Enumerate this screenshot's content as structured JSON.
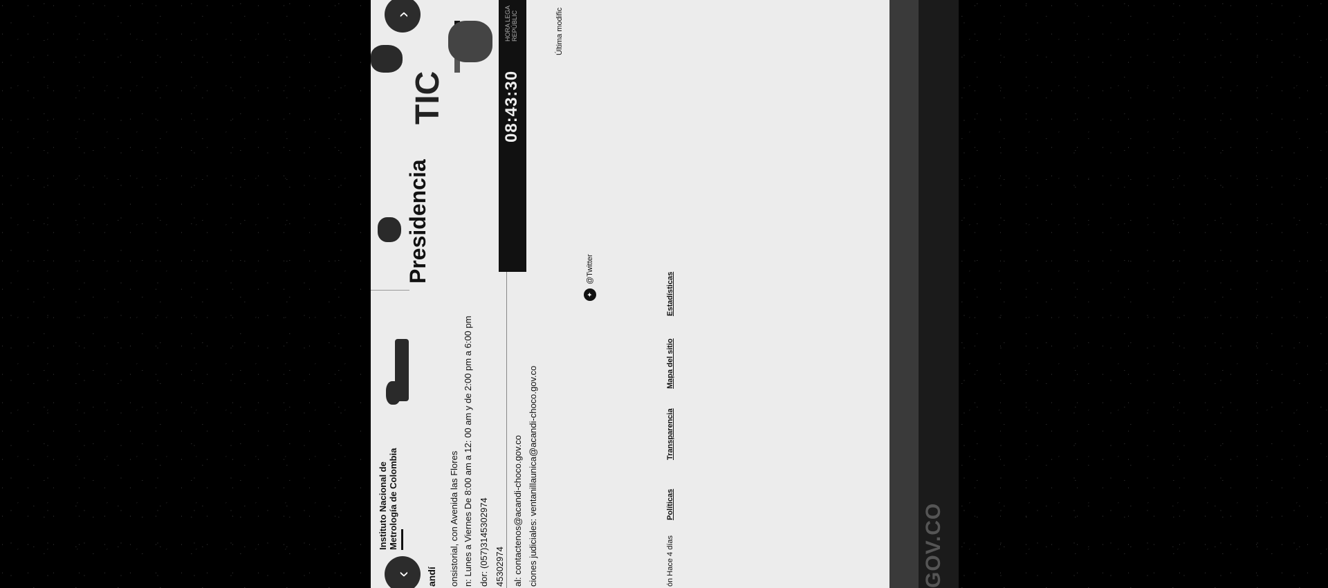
{
  "logos": {
    "inm_name": "Instituto Nacional de Metrología de Colombia",
    "presidencia": "Presidencia",
    "tic": "TIC",
    "carousel_prev_icon": "chevron-down-icon",
    "carousel_next_icon": "chevron-up-icon"
  },
  "footer": {
    "title": "andí",
    "address": "onsistorial, con Avenida las Flores",
    "hours": "n: Lunes a Viernes De 8:00 am a 12: 00 am y de 2:00 pm a 6:00 pm",
    "phone": "dor: (057)3145302974",
    "phone2": "45302974",
    "email": "al: contactenos@acandi-choco.gov.co",
    "judicial": "ciones judiciales: ventanillaunica@acandi-choco.gov.co",
    "clock_time": "08:43:30",
    "clock_label_1": "HORA LEGA",
    "clock_label_2": "REPÚBLIC",
    "last_modified": "Última modific",
    "twitter": "@Twitter",
    "updated": "ón Hace 4 días"
  },
  "links": {
    "politicas": "Políticas",
    "transparencia": "Transparencia",
    "mapa": "Mapa del sitio",
    "estadisticas": "Estadísticas"
  },
  "brand": {
    "govco": "GOV.CO"
  },
  "colors": {
    "page_bg": "#ececec",
    "dark_band": "#3a3a3a",
    "darker_band": "#1b1b1b"
  }
}
